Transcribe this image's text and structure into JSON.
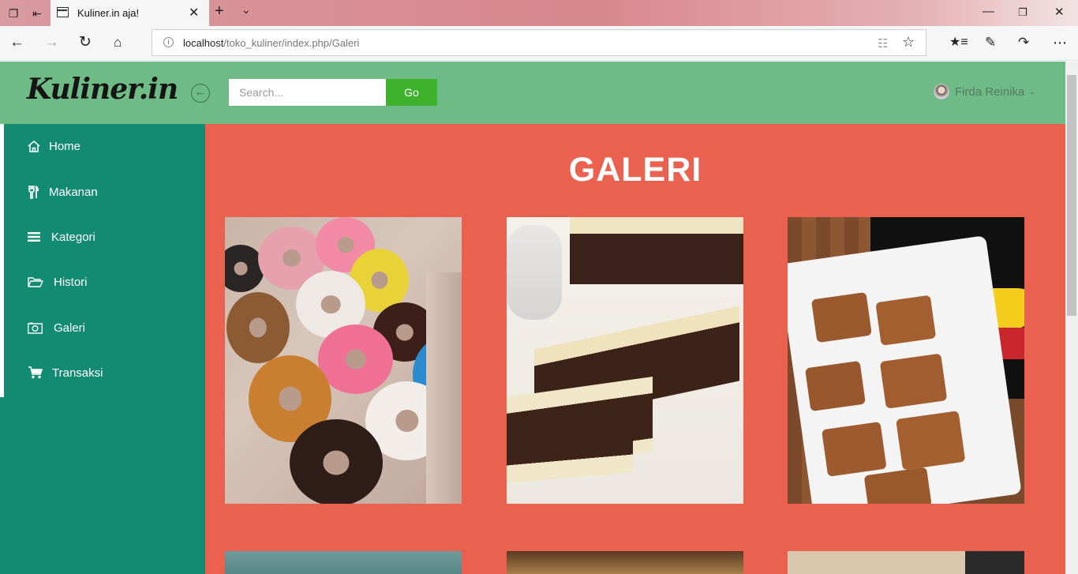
{
  "browser": {
    "tab_title": "Kuliner.in aja!",
    "url_host": "localhost",
    "url_path": "/toko_kuliner/index.php/Galeri"
  },
  "header": {
    "logo": "Kuliner.in",
    "search_placeholder": "Search...",
    "search_button": "Go",
    "user_name": "Firda Reinika"
  },
  "sidebar": {
    "items": [
      {
        "label": "Home",
        "icon": "home-icon"
      },
      {
        "label": "Makanan",
        "icon": "cutlery-icon"
      },
      {
        "label": "Kategori",
        "icon": "list-icon"
      },
      {
        "label": "Histori",
        "icon": "folder-open-icon"
      },
      {
        "label": "Galeri",
        "icon": "camera-icon"
      },
      {
        "label": "Transaksi",
        "icon": "cart-icon"
      }
    ]
  },
  "main": {
    "title": "GALERI",
    "gallery": [
      {
        "subject": "donuts-photo"
      },
      {
        "subject": "chocolate-cake-photo"
      },
      {
        "subject": "pisang-photo"
      },
      {
        "subject": "gallery-photo-4"
      },
      {
        "subject": "gallery-photo-5"
      },
      {
        "subject": "gallery-photo-6"
      }
    ]
  },
  "colors": {
    "header_green": "#6ebb86",
    "sidebar_teal": "#138a72",
    "main_coral": "#ea6150",
    "go_button": "#3eb22d"
  }
}
